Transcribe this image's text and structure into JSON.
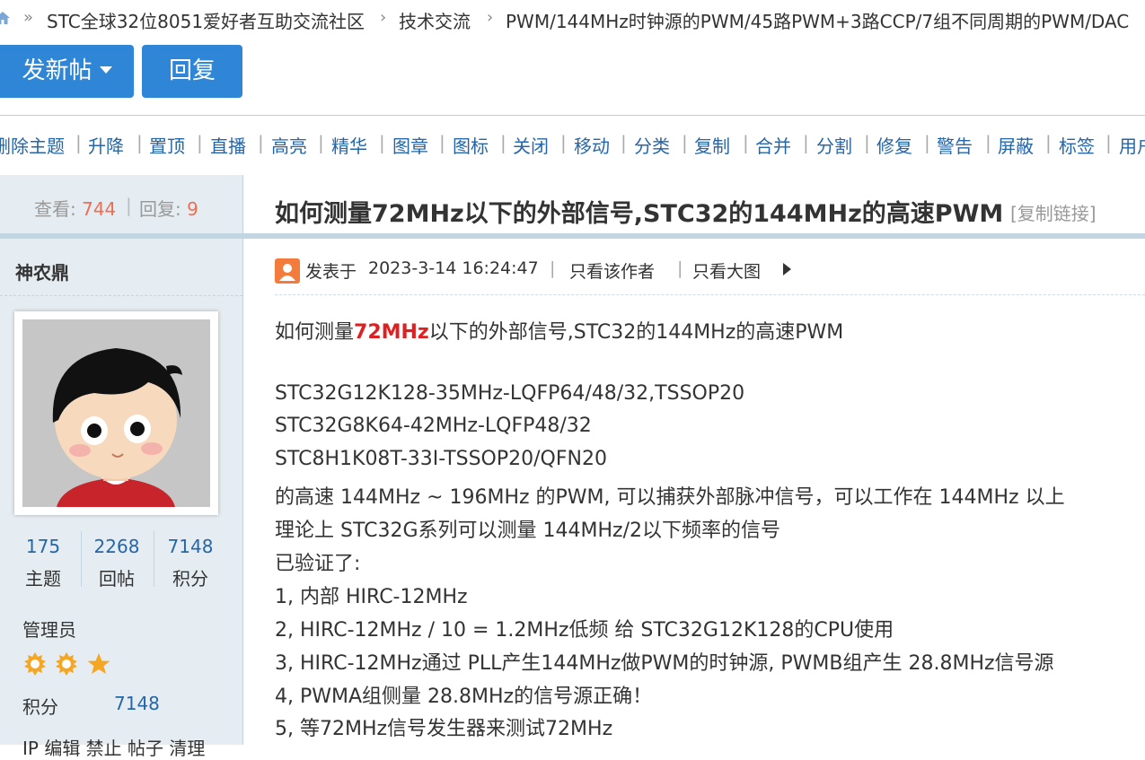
{
  "breadcrumb": {
    "home_icon": "home-icon",
    "items": [
      "STC全球32位8051爱好者互助交流社区",
      "技术交流",
      "PWM/144MHz时钟源的PWM/45路PWM+3路CCP/7组不同周期的PWM/DAC"
    ],
    "separator": "»"
  },
  "actions": {
    "new_post": "发新帖",
    "reply": "回复"
  },
  "moderation": [
    "删除主题",
    "升降",
    "置顶",
    "直播",
    "高亮",
    "精华",
    "图章",
    "图标",
    "关闭",
    "移动",
    "分类",
    "复制",
    "合并",
    "分割",
    "修复",
    "警告",
    "屏蔽",
    "标签",
    "用户"
  ],
  "stats": {
    "views_label": "查看:",
    "views": "744",
    "replies_label": "回复:",
    "replies": "9"
  },
  "author": {
    "name": "神农鼎",
    "threads": "175",
    "threads_label": "主题",
    "posts": "2268",
    "posts_label": "回帖",
    "credits": "7148",
    "credits_label": "积分",
    "role": "管理员",
    "credits_row_label": "积分",
    "credits_row_value": "7148",
    "bottom_links": "IP 编辑 禁止 帖子 清理"
  },
  "post": {
    "title": "如何测量72MHz以下的外部信号,STC32的144MHz的高速PWM",
    "copy_link": "[复制链接]",
    "posted_label": "发表于",
    "posted_time": "2023-3-14 16:24:47",
    "only_author": "只看该作者",
    "only_large_images": "只看大图",
    "body": {
      "line1_a": "如何测量",
      "line1_red": "72MHz",
      "line1_b": "以下的外部信号,STC32的144MHz的高速PWM",
      "lines": [
        "STC32G12K128-35MHz-LQFP64/48/32,TSSOP20",
        "STC32G8K64-42MHz-LQFP48/32",
        "STC8H1K08T-33I-TSSOP20/QFN20",
        "的高速 144MHz ~ 196MHz 的PWM, 可以捕获外部脉冲信号，可以工作在 144MHz 以上",
        "理论上 STC32G系列可以测量 144MHz/2以下频率的信号",
        "已验证了:",
        "1, 内部 HIRC-12MHz",
        "2, HIRC-12MHz / 10 = 1.2MHz低频 给 STC32G12K128的CPU使用",
        "3, HIRC-12MHz通过 PLL产生144MHz做PWM的时钟源, PWMB组产生 28.8MHz信号源",
        "4, PWMA组侧量 28.8MHz的信号源正确！",
        "5, 等72MHz信号发生器来测试72MHz"
      ]
    }
  },
  "colors": {
    "accent": "#2f86d6",
    "link": "#2566a8",
    "highlight": "#e02020",
    "stat_number": "#f26c4f",
    "sidebar_bg": "#e5edf2"
  }
}
